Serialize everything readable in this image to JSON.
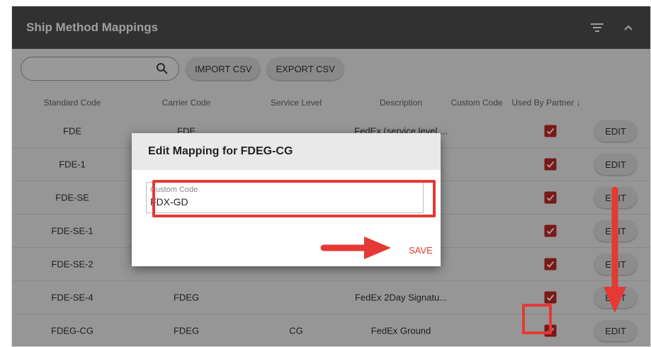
{
  "panel": {
    "title": "Ship Method Mappings"
  },
  "toolbar": {
    "search_placeholder": "",
    "import_label": "IMPORT CSV",
    "export_label": "EXPORT CSV"
  },
  "columns": [
    "Standard Code",
    "Carrier Code",
    "Service Level",
    "Description",
    "Custom Code",
    "Used By Partner ↓"
  ],
  "rows": [
    {
      "standard_code": "FDE",
      "carrier_code": "FDE",
      "service_level": "",
      "description": "FedEx (service level ..."
    },
    {
      "standard_code": "FDE-1",
      "carrier_code": "",
      "service_level": "",
      "description": ""
    },
    {
      "standard_code": "FDE-SE",
      "carrier_code": "",
      "service_level": "",
      "description": ""
    },
    {
      "standard_code": "FDE-SE-1",
      "carrier_code": "",
      "service_level": "",
      "description": ""
    },
    {
      "standard_code": "FDE-SE-2",
      "carrier_code": "",
      "service_level": "",
      "description": ""
    },
    {
      "standard_code": "FDE-SE-4",
      "carrier_code": "FDEG",
      "service_level": "",
      "description": "FedEx 2Day Signatu..."
    },
    {
      "standard_code": "FDEG-CG",
      "carrier_code": "FDEG",
      "service_level": "CG",
      "description": "FedEx Ground"
    }
  ],
  "edit_label": "EDIT",
  "dialog": {
    "title": "Edit Mapping for FDEG-CG",
    "field_label": "Custom Code",
    "field_value": "FDX-GD",
    "save_label": "SAVE"
  },
  "colors": {
    "title_bar": "#4f4f4f",
    "accent_red": "#e53935",
    "checkbox_red": "#c62828"
  }
}
